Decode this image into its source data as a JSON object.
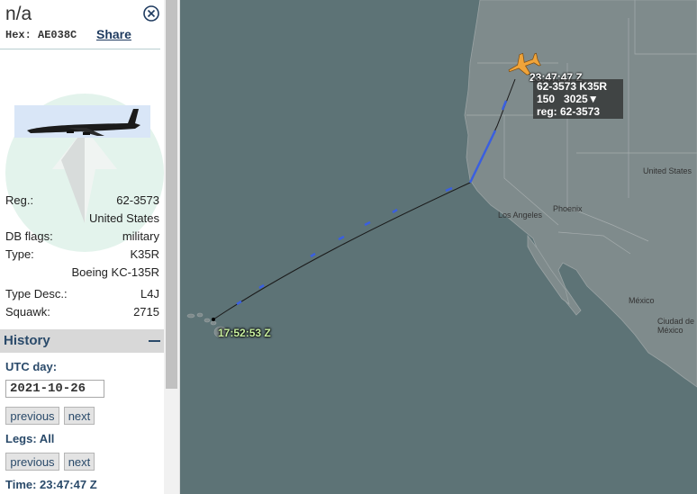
{
  "sidebar": {
    "title": "n/a",
    "hex_label": "Hex:",
    "hex_value": "AE038C",
    "share_label": "Share",
    "fields": [
      {
        "label": "Reg.:",
        "value": "62-3573"
      },
      {
        "label": "",
        "value": "United States"
      },
      {
        "label": "DB flags:",
        "value": "military"
      },
      {
        "label": "Type:",
        "value": "K35R"
      },
      {
        "label": "",
        "value": "Boeing KC-135R"
      },
      {
        "label": "Type Desc.:",
        "value": "L4J"
      },
      {
        "label": "Squawk:",
        "value": "2715"
      }
    ]
  },
  "history": {
    "title": "History",
    "utc_day_label": "UTC day:",
    "date_value": "2021-10-26",
    "previous_label": "previous",
    "next_label": "next",
    "legs_label": "Legs: All",
    "time_label": "Time: 23:47:47 Z"
  },
  "map": {
    "current_time": "23:47:47 Z",
    "aircraft_label_line1": "62-3573 K35R",
    "aircraft_label_line2": "150   3025▼",
    "aircraft_label_line3": "reg: 62-3573",
    "start_time": "17:52:53 Z",
    "place_labels": [
      "Los Angeles",
      "Phoenix",
      "United States",
      "México",
      "Ciudad de México"
    ],
    "colors": {
      "ocean": "#5d7376",
      "land": "#7f8b8c",
      "track": "#1a1a1a",
      "track_blue": "#3a5fe0",
      "aircraft": "#f0a43a"
    }
  }
}
